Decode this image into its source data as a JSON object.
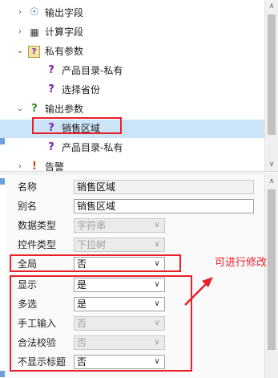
{
  "tree": {
    "items": [
      {
        "label": "输出字段",
        "icon": "output-field-icon",
        "expander": "collapsed"
      },
      {
        "label": "计算字段",
        "icon": "calc-field-icon",
        "expander": "collapsed"
      },
      {
        "label": "私有参数",
        "icon": "private-param-icon",
        "expander": "expanded"
      },
      {
        "label": "产品目录-私有",
        "icon": "question-mark-icon",
        "expander": "none"
      },
      {
        "label": "选择省份",
        "icon": "question-mark-icon",
        "expander": "none"
      },
      {
        "label": "输出参数",
        "icon": "question-mark-icon",
        "expander": "expanded"
      },
      {
        "label": "销售区域",
        "icon": "question-mark-icon",
        "expander": "none",
        "selected": true
      },
      {
        "label": "产品目录-私有",
        "icon": "question-mark-icon",
        "expander": "none"
      },
      {
        "label": "告警",
        "icon": "alert-icon",
        "expander": "collapsed"
      }
    ]
  },
  "props": {
    "name": {
      "label": "名称",
      "value": "销售区域"
    },
    "alias": {
      "label": "别名",
      "value": "销售区域"
    },
    "data_type": {
      "label": "数据类型",
      "value": "字符串"
    },
    "control_type": {
      "label": "控件类型",
      "value": "下拉树"
    },
    "global": {
      "label": "全局",
      "value": "否"
    },
    "display": {
      "label": "显示",
      "value": "是"
    },
    "multi_select": {
      "label": "多选",
      "value": "是"
    },
    "manual_input": {
      "label": "手工输入",
      "value": "否"
    },
    "validity_check": {
      "label": "合法校验",
      "value": "否"
    },
    "hide_title": {
      "label": "不显示标题",
      "value": "否"
    }
  },
  "annotation": {
    "text": "可进行修改"
  },
  "colors": {
    "highlight": "#e8202a",
    "selection": "#cce4f7",
    "purple_icon": "#7a1fb0"
  }
}
